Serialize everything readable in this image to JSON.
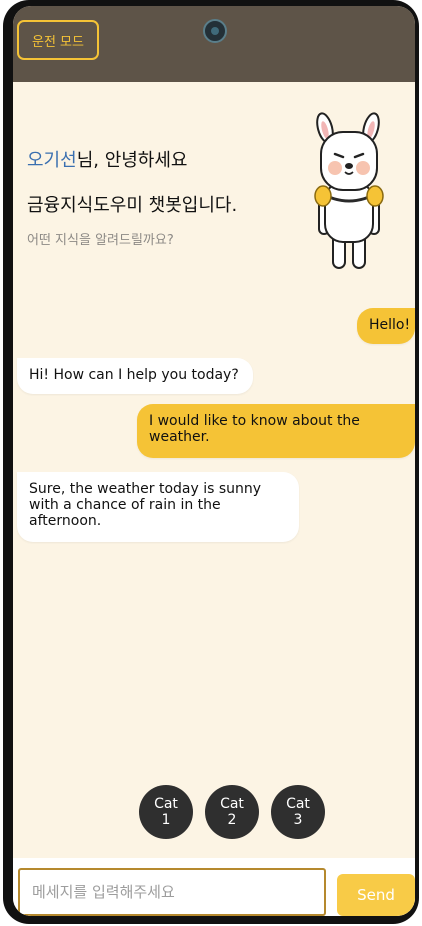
{
  "header": {
    "drive_mode_label": "운전 모드"
  },
  "greeting": {
    "user_name": "오기선",
    "suffix": "님, 안녕하세요",
    "title": "금융지식도우미 챗봇입니다.",
    "subtitle": "어떤 지식을 알려드릴까요?"
  },
  "mascot": {
    "icon": "alpaca-mascot-icon"
  },
  "messages": [
    {
      "sender": "user",
      "text": "Hello!"
    },
    {
      "sender": "bot",
      "text": "Hi! How can I help you today?"
    },
    {
      "sender": "user",
      "text": "I would like to know about the weather."
    },
    {
      "sender": "bot",
      "text": "Sure, the weather today is sunny with a chance of rain in the afternoon."
    }
  ],
  "categories": [
    {
      "line1": "Cat",
      "line2": "1"
    },
    {
      "line1": "Cat",
      "line2": "2"
    },
    {
      "line1": "Cat",
      "line2": "3"
    }
  ],
  "input": {
    "placeholder": "메세지를 입력해주세요",
    "value": "",
    "send_label": "Send"
  },
  "colors": {
    "accent": "#f5c336",
    "header_bg": "#5e5448",
    "screen_bg": "#fcf4e4",
    "name_color": "#3a6fb0",
    "category_bg": "#2f2f2f"
  }
}
